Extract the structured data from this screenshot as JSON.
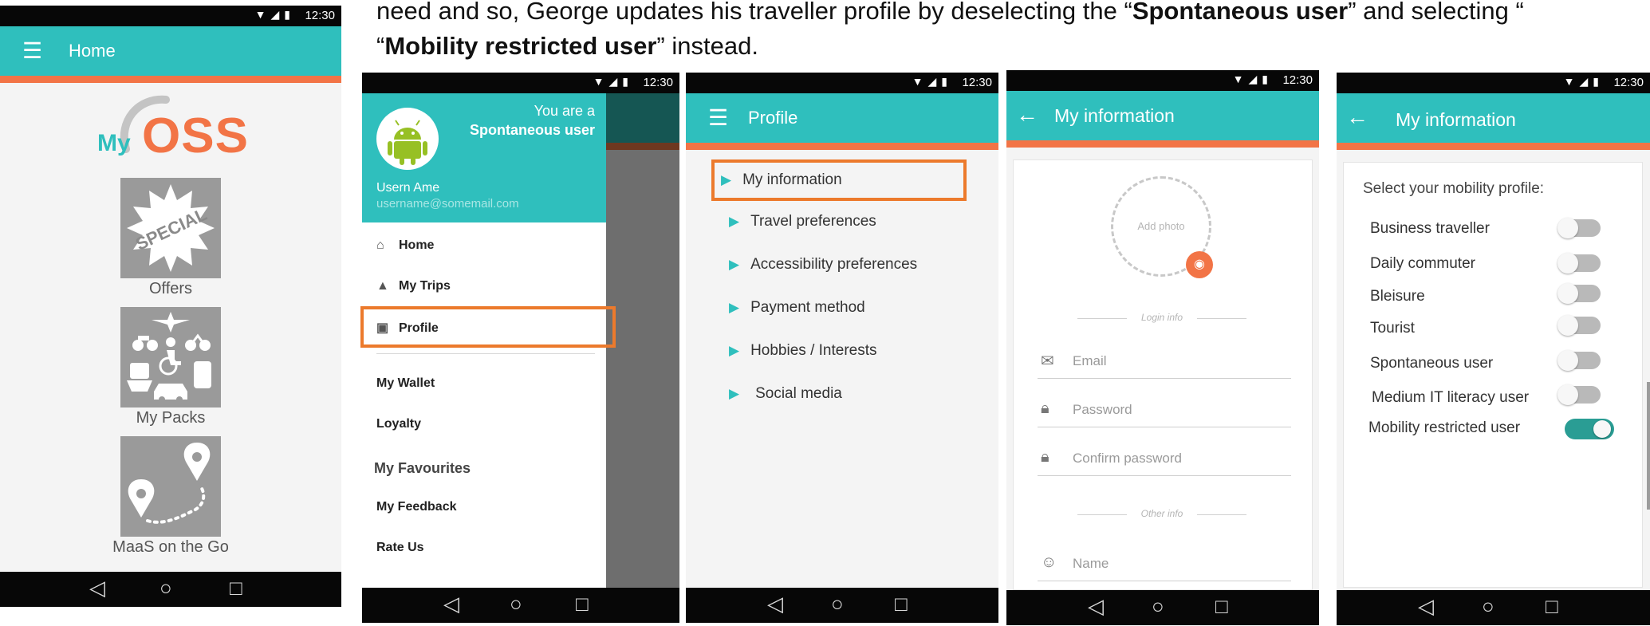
{
  "caption": {
    "line1_start": "need and so, George updates his traveller profile by deselecting the “",
    "line1_bold": "Spontaneous user",
    "line1_end": "” and selecting “",
    "line2_open": "“",
    "line2_bold": "Mobility restricted user",
    "line2_end": "” instead."
  },
  "status_time": "12:30",
  "colors": {
    "teal": "#2fbfbd",
    "orange": "#f27446",
    "highlight": "#ec7a2c"
  },
  "screen_home": {
    "title": "Home",
    "logo_my": "My",
    "logo_oss": "OSS",
    "special_text": "SPECIAL",
    "tiles": [
      {
        "label": "Offers",
        "icon": "special-badge-icon"
      },
      {
        "label": "My Packs",
        "icon": "transport-modes-icon"
      },
      {
        "label": "MaaS on the Go",
        "icon": "route-map-icon"
      }
    ]
  },
  "screen_drawer": {
    "you_are": "You are a",
    "user_type": "Spontaneous user",
    "user_name": "Usern Ame",
    "user_email": "username@somemail.com",
    "items_primary": [
      "Home",
      "My Trips",
      "Profile"
    ],
    "items_secondary": [
      "My Wallet",
      "Loyalty"
    ],
    "section_header": "My Favourites",
    "items_tertiary": [
      "My Feedback",
      "Rate Us"
    ]
  },
  "screen_profile": {
    "title": "Profile",
    "items": [
      "My information",
      "Travel preferences",
      "Accessibility preferences",
      "Payment method",
      "Hobbies / Interests",
      "Social media"
    ]
  },
  "screen_myinfo": {
    "title": "My information",
    "add_photo": "Add photo",
    "login_info": "Login info",
    "other_info": "Other info",
    "fields": [
      "Email",
      "Password",
      "Confirm password",
      "Name"
    ]
  },
  "screen_mobility": {
    "title": "My information",
    "prompt": "Select your mobility profile:",
    "options": [
      {
        "label": "Business traveller",
        "on": false
      },
      {
        "label": "Daily commuter",
        "on": false
      },
      {
        "label": "Bleisure",
        "on": false
      },
      {
        "label": "Tourist",
        "on": false
      },
      {
        "label": "Spontaneous user",
        "on": false
      },
      {
        "label": "Medium IT literacy user",
        "on": false
      },
      {
        "label": "Mobility restricted user",
        "on": true
      }
    ]
  }
}
